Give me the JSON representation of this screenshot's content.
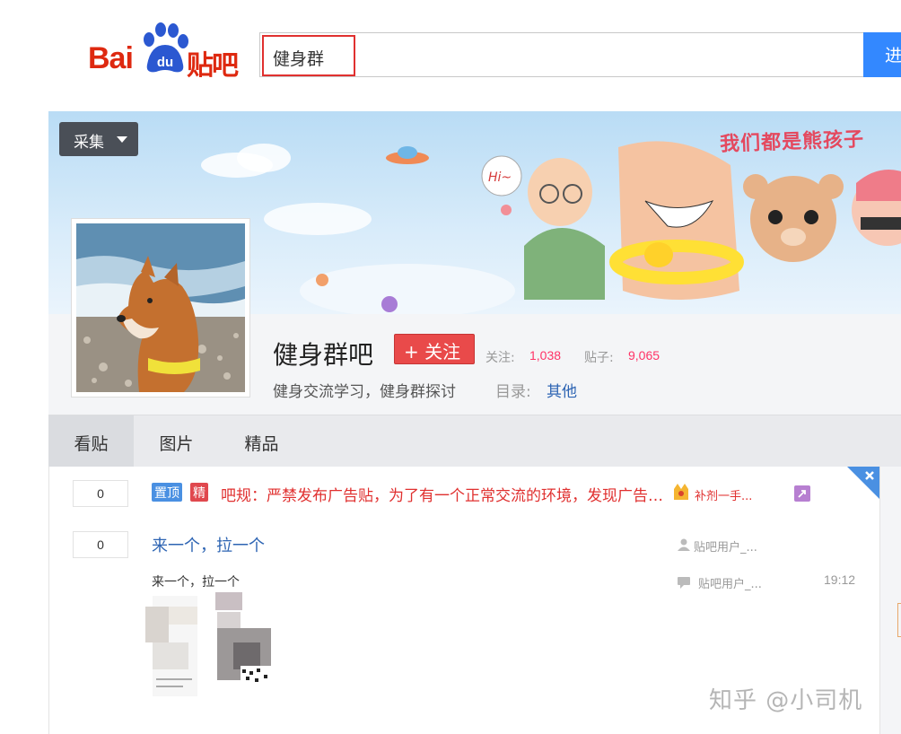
{
  "header": {
    "logo_text": "Bai du 贴吧",
    "search_value": "健身群",
    "search_button": "进"
  },
  "banner": {
    "collect_label": "采集",
    "slogan": "我们都是熊孩子",
    "bubble_text": "Hi~"
  },
  "forum": {
    "name": "健身群吧",
    "follow_label": "+ 关注",
    "followers_label": "关注:",
    "followers": "1,038",
    "posts_label": "贴子:",
    "posts": "9,065",
    "description": "健身交流学习，健身群探讨",
    "directory_label": "目录:",
    "directory_value": "其他"
  },
  "tabs": [
    {
      "label": "看贴",
      "active": true
    },
    {
      "label": "图片",
      "active": false
    },
    {
      "label": "精品",
      "active": false
    }
  ],
  "threads": [
    {
      "replies": "0",
      "badges": [
        {
          "text": "置顶",
          "color": "#4a90e2"
        },
        {
          "text": "精",
          "color": "#e0484e"
        }
      ],
      "title": "吧规：严禁发布广告贴，为了有一个正常交流的环境，发现广告一律删帖封禁",
      "author": "补剂一手..."
    },
    {
      "replies": "0",
      "title": "来一个，拉一个",
      "abstract": "来一个，拉一个",
      "author": "贴吧用户_...",
      "last_reply_user": "贴吧用户_...",
      "time": "19:12"
    }
  ],
  "watermark": "知乎 @小司机",
  "colors": {
    "brand_red": "#de2910",
    "search_blue": "#3388ff",
    "link_blue": "#2d64b3"
  }
}
